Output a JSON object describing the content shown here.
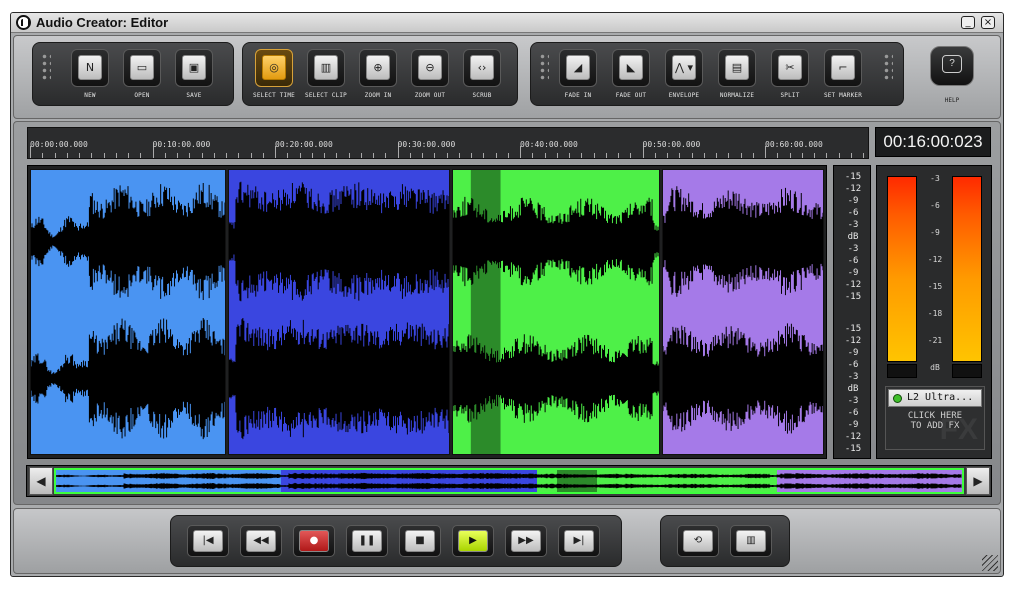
{
  "window": {
    "title": "Audio Creator: Editor",
    "minimize_glyph": "_",
    "close_glyph": "×"
  },
  "toolbar": {
    "file_buttons": [
      {
        "label": "NEW",
        "icon": "new-file-icon",
        "glyph": "N"
      },
      {
        "label": "OPEN",
        "icon": "open-folder-icon",
        "glyph": "▭"
      },
      {
        "label": "SAVE",
        "icon": "save-disk-icon",
        "glyph": "▣"
      }
    ],
    "view_buttons": [
      {
        "label": "SELECT TIME",
        "icon": "select-time-icon",
        "glyph": "◎",
        "active": true
      },
      {
        "label": "SELECT CLIP",
        "icon": "select-clip-icon",
        "glyph": "▥",
        "active": false
      },
      {
        "label": "ZOOM IN",
        "icon": "zoom-in-icon",
        "glyph": "⊕",
        "active": false
      },
      {
        "label": "ZOOM OUT",
        "icon": "zoom-out-icon",
        "glyph": "⊖",
        "active": false
      },
      {
        "label": "SCRUB",
        "icon": "scrub-icon",
        "glyph": "‹›",
        "active": false
      }
    ],
    "edit_buttons": [
      {
        "label": "FADE IN",
        "icon": "fade-in-icon",
        "glyph": "◢"
      },
      {
        "label": "FADE OUT",
        "icon": "fade-out-icon",
        "glyph": "◣"
      },
      {
        "label": "ENVELOPE",
        "icon": "envelope-icon",
        "glyph": "⋀ ▾"
      },
      {
        "label": "NORMALIZE",
        "icon": "normalize-icon",
        "glyph": "▤"
      },
      {
        "label": "SPLIT",
        "icon": "split-scissors-icon",
        "glyph": "✂"
      },
      {
        "label": "SET MARKER",
        "icon": "set-marker-icon",
        "glyph": "⌐"
      }
    ],
    "help": {
      "label": "HELP",
      "icon": "help-icon",
      "glyph": "?"
    }
  },
  "timeline": {
    "ruler_labels": [
      "00:00:00.000",
      "00:10:00.000",
      "00:20:00.000",
      "00:30:00.000",
      "00:40:00.000",
      "00:50:00.000",
      "00:60:00.000"
    ],
    "time_display": "00:16:00:023"
  },
  "clips": [
    {
      "name": "clip-1",
      "color": "#4a94f2"
    },
    {
      "name": "clip-2",
      "color": "#3a46e0"
    },
    {
      "name": "clip-3",
      "color": "#4ef048",
      "selection_color": "#2c8b2a"
    },
    {
      "name": "clip-4",
      "color": "#a57ae8"
    }
  ],
  "db_scale": [
    "-15",
    "-12",
    "-9",
    "-6",
    "-3",
    "dB",
    "-3",
    "-6",
    "-9",
    "-12",
    "-15",
    "-15",
    "-12",
    "-9",
    "-6",
    "-3",
    "dB",
    "-3",
    "-6",
    "-9",
    "-12",
    "-15"
  ],
  "meters": {
    "scale": [
      "-3",
      "-6",
      "-9",
      "-12",
      "-15",
      "-18",
      "-21",
      "dB"
    ],
    "fx_plugin": "L2 Ultra...",
    "fx_hint_line1": "CLICK HERE",
    "fx_hint_line2": "TO ADD FX",
    "fx_watermark": "FX"
  },
  "overview": {
    "left_glyph": "◀",
    "right_glyph": "▶"
  },
  "transport": {
    "buttons": [
      {
        "name": "go-to-start-button",
        "icon": "skip-back-icon",
        "glyph": "|◀"
      },
      {
        "name": "rewind-button",
        "icon": "rewind-icon",
        "glyph": "◀◀"
      },
      {
        "name": "record-button",
        "icon": "record-icon",
        "glyph": "●",
        "kind": "rec"
      },
      {
        "name": "pause-button",
        "icon": "pause-icon",
        "glyph": "❚❚"
      },
      {
        "name": "stop-button",
        "icon": "stop-icon",
        "glyph": "■"
      },
      {
        "name": "play-button",
        "icon": "play-icon",
        "glyph": "▶",
        "kind": "play"
      },
      {
        "name": "fast-forward-button",
        "icon": "fast-forward-icon",
        "glyph": "▶▶"
      },
      {
        "name": "go-to-end-button",
        "icon": "skip-end-icon",
        "glyph": "▶|"
      }
    ],
    "extra_buttons": [
      {
        "name": "loop-button",
        "icon": "loop-icon",
        "glyph": "⟲"
      },
      {
        "name": "mixer-button",
        "icon": "mixer-icon",
        "glyph": "▥"
      }
    ]
  }
}
